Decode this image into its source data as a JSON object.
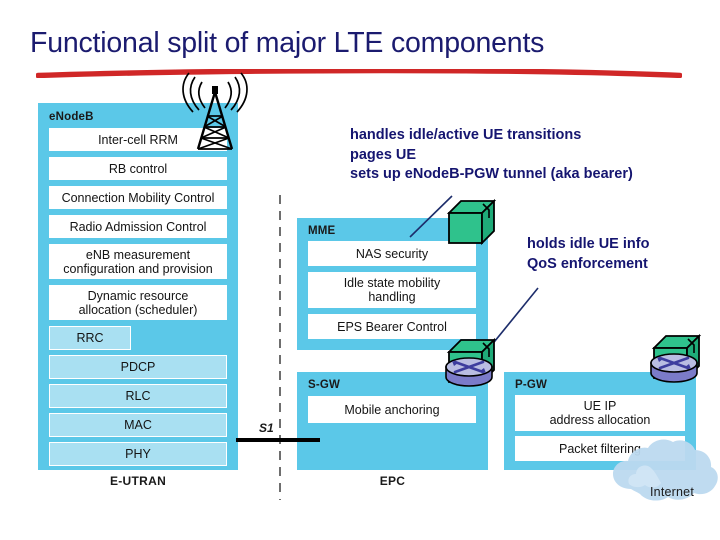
{
  "slide": {
    "title": "Functional split of major LTE components"
  },
  "enodeb": {
    "label": "eNodeB",
    "caption": "E-UTRAN",
    "functions": [
      "Inter-cell RRM",
      "RB control",
      "Connection Mobility Control",
      "Radio Admission Control",
      "eNB measurement\nconfiguration and provision",
      "Dynamic resource\nallocation (scheduler)"
    ],
    "layers": [
      "RRC",
      "PDCP",
      "RLC",
      "MAC",
      "PHY"
    ]
  },
  "mme": {
    "label": "MME",
    "functions": [
      "NAS security",
      "Idle state mobility\nhandling",
      "EPS Bearer Control"
    ]
  },
  "sgw": {
    "label": "S-GW",
    "caption": "EPC",
    "functions": [
      "Mobile anchoring"
    ]
  },
  "pgw": {
    "label": "P-GW",
    "functions": [
      "UE IP\naddress allocation",
      "Packet filtering"
    ]
  },
  "interfaces": {
    "s1": "S1"
  },
  "internet": {
    "label": "Internet"
  },
  "annotations": {
    "mme_note": "handles idle/active UE transitions\npages UE\nsets up eNodeB-PGW tunnel (aka bearer)",
    "gw_note": "holds idle UE info\nQoS enforcement"
  },
  "icons": {
    "antenna": "antenna-tower-icon",
    "server_box": "server-box-icon",
    "router": "router-icon",
    "cloud": "cloud-icon"
  },
  "colors": {
    "title_text": "#1b1b6f",
    "title_rule": "#d02727",
    "node_fill": "#5bc8e8",
    "node_row_fill": "#ffffff",
    "node_layer_fill": "#a9e0f2",
    "annotation_text": "#151570",
    "leader_line": "#1d2d6b",
    "server_green": "#2fc28c",
    "router_purple": "#6b6bc4",
    "cloud_blue": "#bcd9ef",
    "s1_line": "#000000"
  }
}
